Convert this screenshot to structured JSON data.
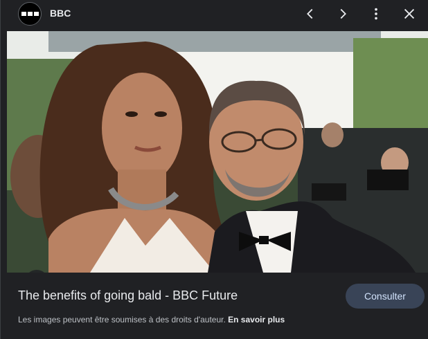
{
  "header": {
    "source_name": "BBC",
    "source_logo_icon": "bbc-logo-icon",
    "prev_icon": "chevron-left-icon",
    "next_icon": "chevron-right-icon",
    "more_icon": "more-vert-icon",
    "close_icon": "close-icon"
  },
  "image": {
    "lens_icon": "google-lens-icon"
  },
  "result": {
    "title": "The benefits of going bald - BBC Future",
    "visit_label": "Consulter",
    "copyright_text": "Les images peuvent être soumises à des droits d'auteur.",
    "learn_more_label": "En savoir plus"
  },
  "colors": {
    "background": "#202124",
    "visit_button_bg": "#394457",
    "visit_button_text": "#d2e3fc"
  }
}
